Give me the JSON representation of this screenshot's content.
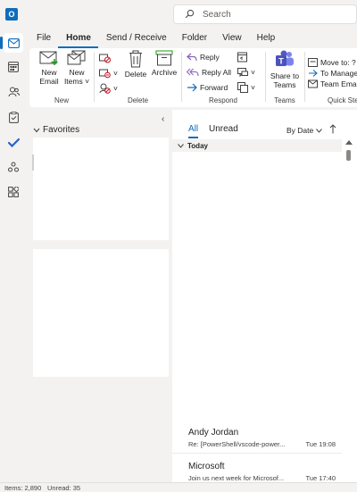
{
  "title_bar": {
    "search_placeholder": "Search"
  },
  "ribbon_tabs": [
    "File",
    "Home",
    "Send / Receive",
    "Folder",
    "View",
    "Help"
  ],
  "ribbon": {
    "new_group": {
      "label": "New",
      "new_email": "New Email",
      "new_items": "New Items"
    },
    "delete_group": {
      "label": "Delete",
      "delete": "Delete",
      "archive": "Archive"
    },
    "respond_group": {
      "label": "Respond",
      "reply": "Reply",
      "reply_all": "Reply All",
      "forward": "Forward"
    },
    "teams_group": {
      "label": "Teams",
      "share": "Share to Teams"
    },
    "quick_steps_group": {
      "label": "Quick Steps",
      "move_to": "Move to: ?",
      "to_manager": "To Manager",
      "team_email": "Team Email"
    }
  },
  "folder_pane": {
    "favorites": "Favorites"
  },
  "mail_list": {
    "filter_all": "All",
    "filter_unread": "Unread",
    "sort": "By Date",
    "group_today": "Today",
    "items": [
      {
        "sender": "Andy Jordan",
        "subject": "Re: [PowerShell/vscode-power...",
        "time": "Tue 19:08"
      },
      {
        "sender": "Microsoft",
        "subject": "Join us next week for Microsof...",
        "time": "Tue 17:40"
      }
    ]
  },
  "status_bar": {
    "items": "Items: 2,890",
    "unread": "Unread: 35"
  },
  "colors": {
    "accent": "#0f6cbd",
    "background": "#f3f2f1",
    "surface": "#ffffff"
  },
  "icons": [
    "outlook-logo-icon",
    "search-icon",
    "mail-icon",
    "calendar-icon",
    "people-icon",
    "tasks-icon",
    "todo-icon",
    "groups-icon",
    "apps-icon",
    "new-email-icon",
    "new-items-icon",
    "ignore-icon",
    "cleanup-icon",
    "junk-icon",
    "delete-icon",
    "archive-icon",
    "reply-icon",
    "reply-all-icon",
    "forward-icon",
    "teams-icon",
    "move-to-icon",
    "to-manager-icon",
    "team-email-icon"
  ]
}
